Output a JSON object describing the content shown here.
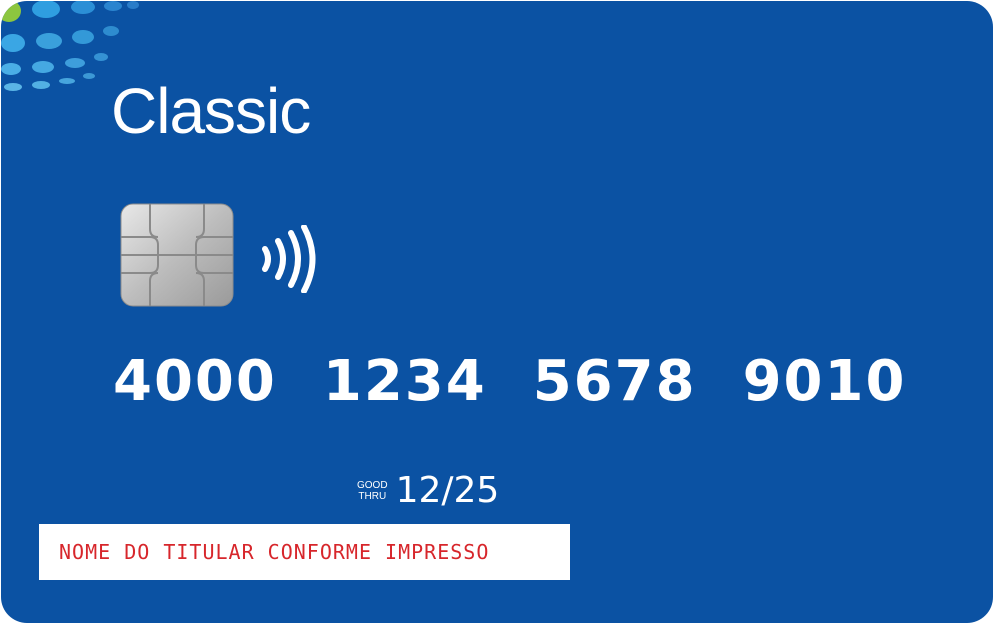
{
  "card": {
    "product_name": "Classic",
    "number_groups": [
      "4000",
      "1234",
      "5678",
      "9010"
    ],
    "good_thru_line1": "GOOD",
    "good_thru_line2": "THRU",
    "expiry": "12/25",
    "holder_name": "NOME DO TITULAR CONFORME IMPRESSO"
  },
  "colors": {
    "card_blue": "#0b52a3",
    "text_white": "#ffffff",
    "name_red": "#d7262b",
    "accent_green": "#8cc63f",
    "accent_lightblue": "#3aa0dc"
  },
  "icons": {
    "chip": "emv-chip-icon",
    "contactless": "contactless-icon",
    "decoration": "dot-pattern"
  }
}
